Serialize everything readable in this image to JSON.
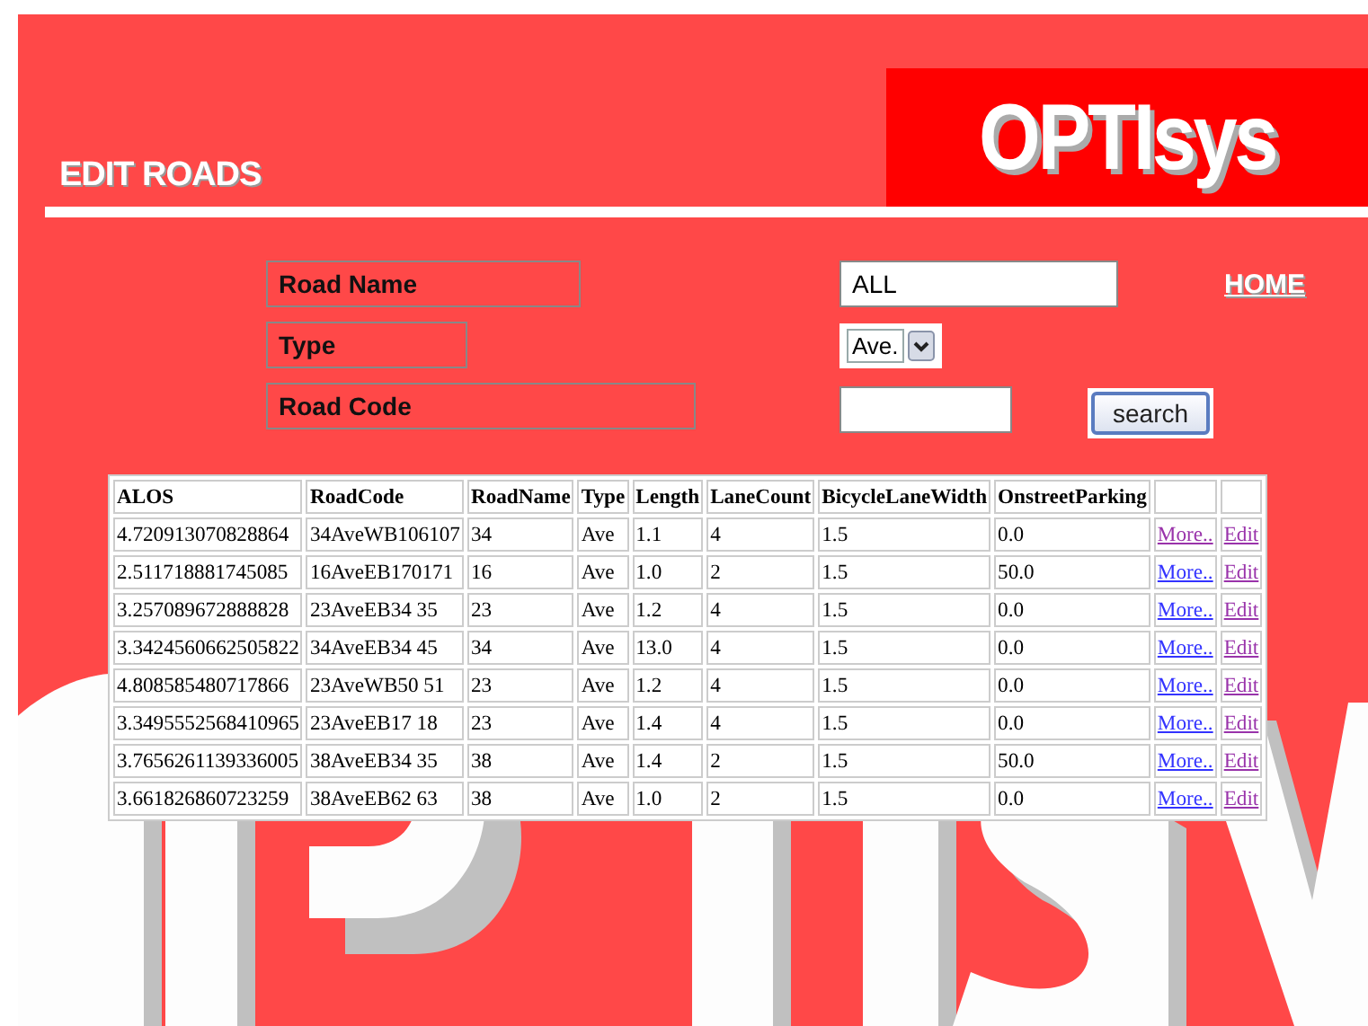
{
  "header": {
    "page_title": "EDIT ROADS",
    "logo": "OPTIsys"
  },
  "form": {
    "fields": [
      {
        "label": "Road Name",
        "kind": "text",
        "value": "ALL"
      },
      {
        "label": "Type",
        "kind": "select",
        "value": "Ave."
      },
      {
        "label": "Road Code",
        "kind": "text"
      }
    ],
    "home_link": "HOME",
    "search_button": "search"
  },
  "table": {
    "columns": [
      "ALOS",
      "RoadCode",
      "RoadName",
      "Type",
      "Length",
      "LaneCount",
      "BicycleLaneWidth",
      "OnstreetParking"
    ],
    "rows": [
      {
        "cells": [
          "4.720913070828864",
          "34AveWB106107",
          "34",
          "Ave",
          "1.1",
          "4",
          "1.5",
          "0.0"
        ],
        "more": {
          "label": "More..",
          "visited": true
        },
        "edit": {
          "label": "Edit",
          "visited": true
        }
      },
      {
        "cells": [
          "2.511718881745085",
          "16AveEB170171",
          "16",
          "Ave",
          "1.0",
          "2",
          "1.5",
          "50.0"
        ],
        "more": {
          "label": "More..",
          "visited": false
        },
        "edit": {
          "label": "Edit",
          "visited": true
        }
      },
      {
        "cells": [
          "3.257089672888828",
          "23AveEB34 35",
          "23",
          "Ave",
          "1.2",
          "4",
          "1.5",
          "0.0"
        ],
        "more": {
          "label": "More..",
          "visited": false
        },
        "edit": {
          "label": "Edit",
          "visited": true
        }
      },
      {
        "cells": [
          "3.3424560662505822",
          "34AveEB34 45",
          "34",
          "Ave",
          "13.0",
          "4",
          "1.5",
          "0.0"
        ],
        "more": {
          "label": "More..",
          "visited": false
        },
        "edit": {
          "label": "Edit",
          "visited": true
        }
      },
      {
        "cells": [
          "4.808585480717866",
          "23AveWB50 51",
          "23",
          "Ave",
          "1.2",
          "4",
          "1.5",
          "0.0"
        ],
        "more": {
          "label": "More..",
          "visited": false
        },
        "edit": {
          "label": "Edit",
          "visited": true
        }
      },
      {
        "cells": [
          "3.3495552568410965",
          "23AveEB17 18",
          "23",
          "Ave",
          "1.4",
          "4",
          "1.5",
          "0.0"
        ],
        "more": {
          "label": "More..",
          "visited": false
        },
        "edit": {
          "label": "Edit",
          "visited": true
        }
      },
      {
        "cells": [
          "3.7656261139336005",
          "38AveEB34 35",
          "38",
          "Ave",
          "1.4",
          "2",
          "1.5",
          "50.0"
        ],
        "more": {
          "label": "More..",
          "visited": false
        },
        "edit": {
          "label": "Edit",
          "visited": true
        }
      },
      {
        "cells": [
          "3.661826860723259",
          "38AveEB62 63",
          "38",
          "Ave",
          "1.0",
          "2",
          "1.5",
          "0.0"
        ],
        "more": {
          "label": "More..",
          "visited": false
        },
        "edit": {
          "label": "Edit",
          "visited": true
        }
      }
    ]
  }
}
